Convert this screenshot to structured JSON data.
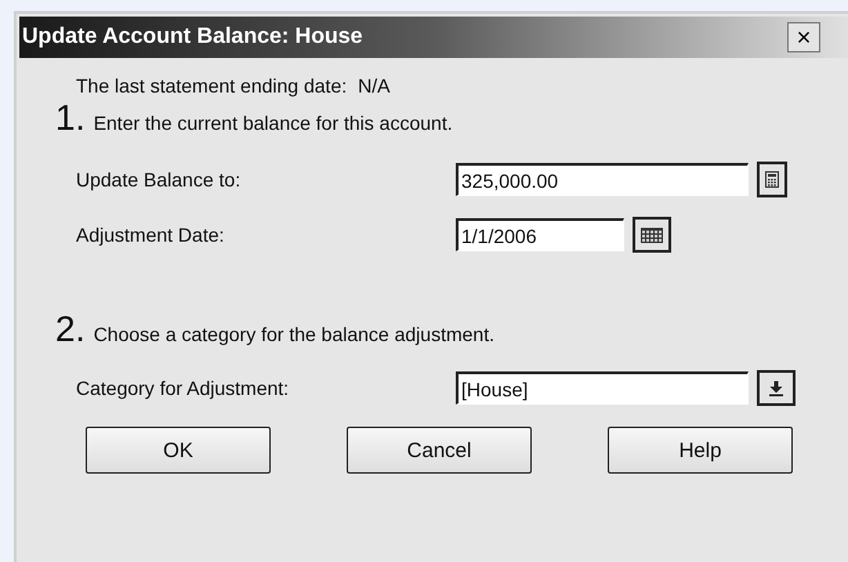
{
  "window": {
    "title": "Update Account Balance: House",
    "close": "×"
  },
  "statement": {
    "label": "The last statement ending date:",
    "value": "N/A"
  },
  "steps": [
    {
      "number": "1.",
      "text": "Enter the current balance for this account."
    },
    {
      "number": "2.",
      "text": "Choose a category for the balance adjustment."
    }
  ],
  "fields": [
    {
      "kind": "calculator",
      "label": "Update Balance to:",
      "value": "325,000.00"
    },
    {
      "kind": "date",
      "label": "Adjustment Date:",
      "value": "1/1/2006"
    }
  ],
  "category": {
    "label": "Category for Adjustment:",
    "value": "[House]"
  },
  "buttons": [
    "OK",
    "Cancel",
    "Help"
  ]
}
